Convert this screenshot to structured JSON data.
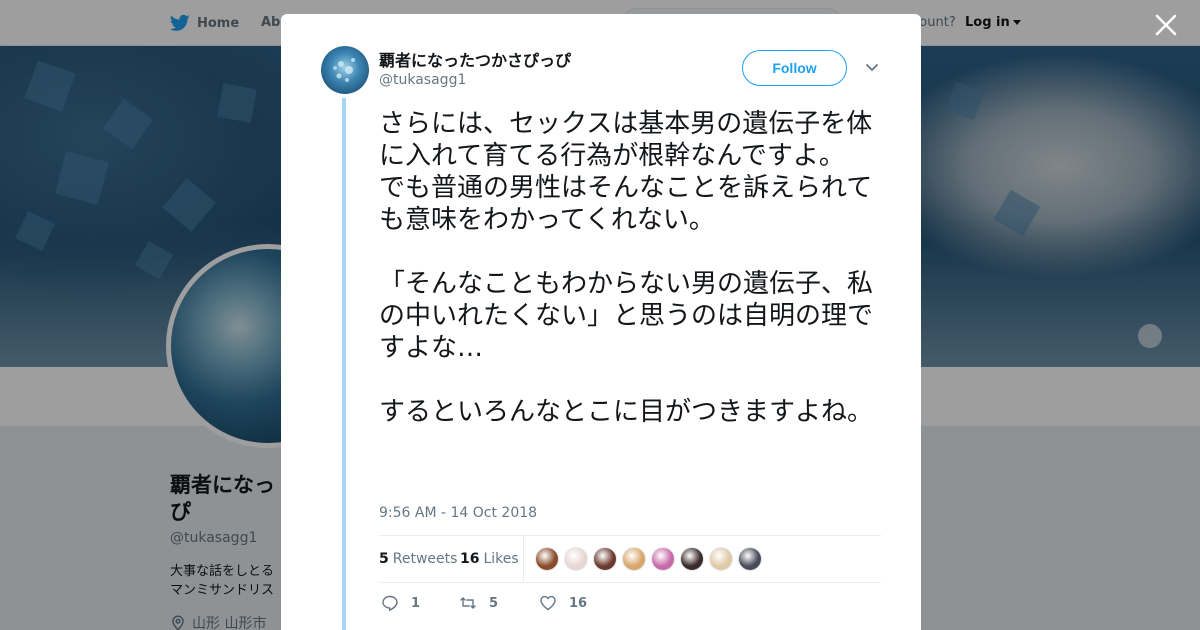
{
  "topnav": {
    "home_label": "Home",
    "about_label": "Abo",
    "account_text": "ccount?",
    "login_label": "Log in",
    "brand_color": "#1da1f2"
  },
  "profile": {
    "name": "覇者になっ\nぴ",
    "handle": "@tukasagg1",
    "bio": "大事な話をしとる\nマンミサンドリス",
    "location": "山形 山形市"
  },
  "tweet": {
    "author_name": "覇者になったつかさぴっぴ",
    "author_handle": "@tukasagg1",
    "follow_label": "Follow",
    "text": "さらには、セックスは基本男の遺伝子を体に入れて育てる行為が根幹なんですよ。\nでも普通の男性はそんなことを訴えられても意味をわかってくれない。\n\n「そんなこともわからない男の遺伝子、私の中いれたくない」と思うのは自明の理ですよな…\n\nするといろんなとこに目がつきますよね。",
    "timestamp": "9:56 AM - 14 Oct 2018",
    "retweets_count": "5",
    "retweets_label": "Retweets",
    "likes_count": "16",
    "likes_label": "Likes",
    "liker_avatar_colors": [
      "#8a4b2a",
      "#e8d6d2",
      "#6b3a2e",
      "#d9a66a",
      "#c86aa8",
      "#3a2a28",
      "#e0c9a6",
      "#4a4a5a"
    ],
    "reply_count": "1",
    "retweet_action_count": "5",
    "like_action_count": "16"
  }
}
